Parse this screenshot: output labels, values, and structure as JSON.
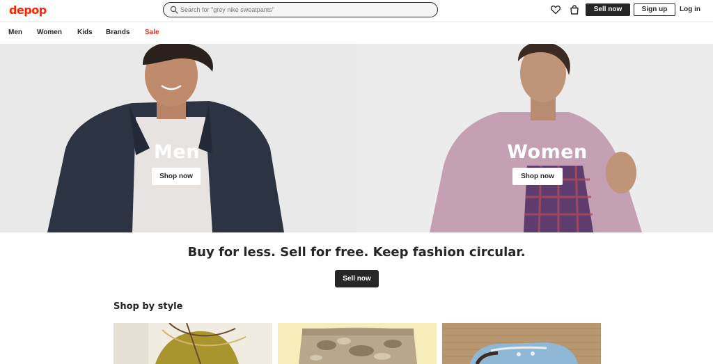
{
  "header": {
    "logo": "depop",
    "search_placeholder": "Search for \"grey nike sweatpants\"",
    "sell_label": "Sell now",
    "signup_label": "Sign up",
    "login_label": "Log in"
  },
  "nav": {
    "items": [
      "Men",
      "Women",
      "Kids",
      "Brands",
      "Sale"
    ]
  },
  "hero": {
    "left": {
      "title": "Men",
      "button": "Shop now"
    },
    "right": {
      "title": "Women",
      "button": "Shop now"
    }
  },
  "promo": {
    "tagline": "Buy for less. Sell for free. Keep fashion circular.",
    "button": "Sell now"
  },
  "style_section": {
    "title": "Shop by style"
  },
  "colors": {
    "brand": "#ff2300",
    "sale": "#e0321e",
    "dark": "#262626"
  }
}
